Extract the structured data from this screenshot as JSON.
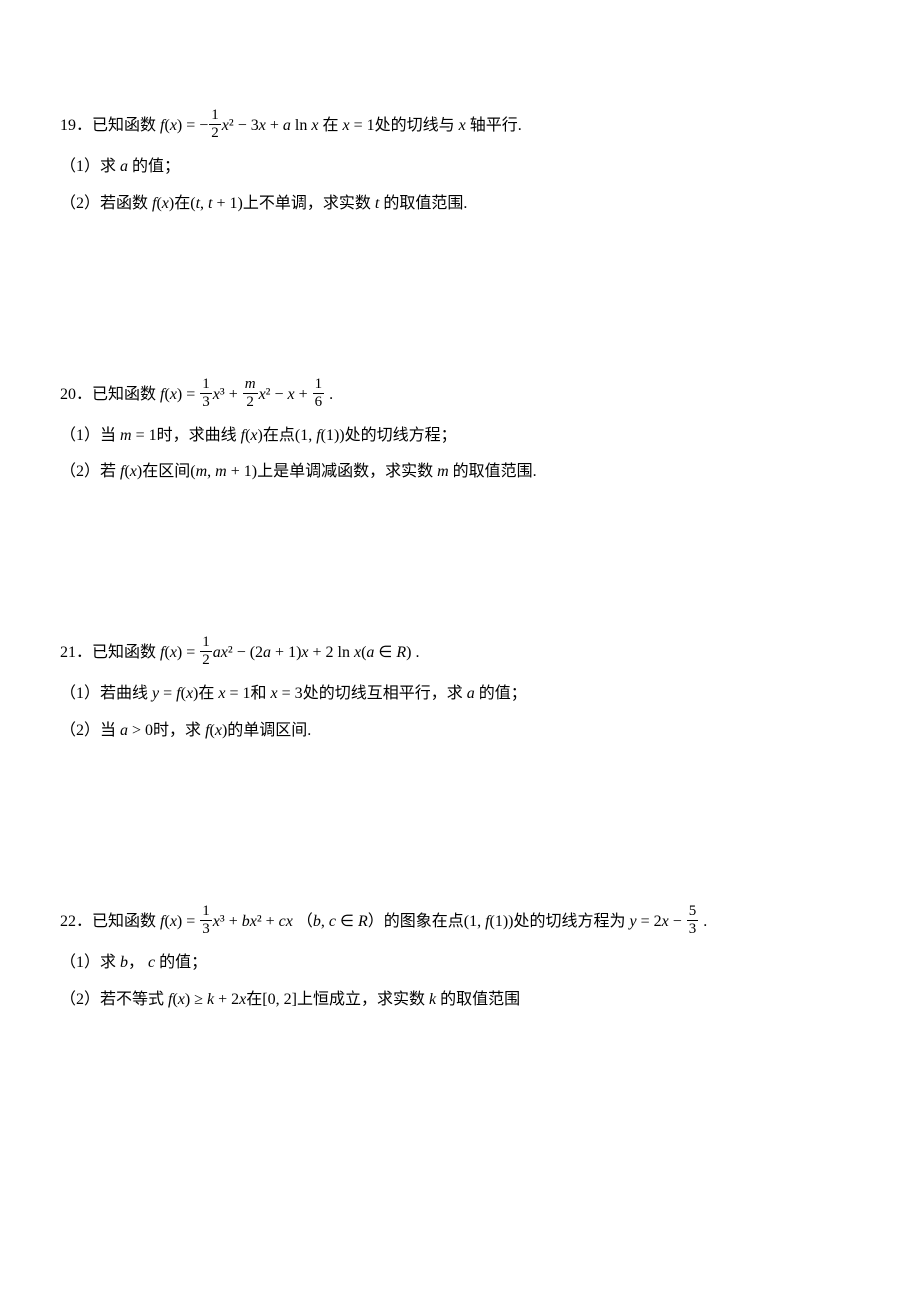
{
  "problems": {
    "p19": {
      "num": "19．",
      "stem_pre": "已知函数",
      "fx": "f",
      "stem_mid1": "(",
      "stem_mid2": ") = −",
      "frac1top": "1",
      "frac1bot": "2",
      "stem_mid3": "² − 3",
      "stem_mid4": " + ",
      "aln": "a",
      "ln": " ln ",
      "stem_mid5": " 在",
      "xeq1": " = 1",
      "stem_mid6": "处的切线与",
      "stem_mid7": "轴平行.",
      "part1": "（1）求",
      "part1_var": "a",
      "part1_end": "的值；",
      "part2": "（2）若函数",
      "part2_f": "f",
      "part2_mid1": "(",
      "part2_mid2": ")在(",
      "part2_t": "t",
      "part2_comma": ", ",
      "part2_t1": "t",
      "part2_plus1": " + 1)",
      "part2_end": "上不单调，求实数",
      "part2_tvar": "t",
      "part2_fin": "的取值范围."
    },
    "p20": {
      "num": "20．",
      "stem_pre": "已知函数",
      "fx": "f",
      "paren1": "(",
      "paren2": ") = ",
      "f1t": "1",
      "f1b": "3",
      "x3": "³ + ",
      "f2t_m": "m",
      "f2b": "2",
      "x2": "² − ",
      "xplus": " + ",
      "f3t": "1",
      "f3b": "6",
      "period": " .",
      "part1": "（1）当",
      "meq1": "m",
      "meq1b": " = 1",
      "part1_mid": "时，求曲线",
      "part1_f": "f",
      "part1_xp": "(",
      "part1_xp2": ")",
      "part1_mid2": "在点",
      "pt1": "(1, ",
      "pt_f": "f",
      "pt2": "(1))",
      "part1_end": "处的切线方程；",
      "part2": "（2）若",
      "p2_f": "f",
      "p2_x1": "(",
      "p2_x2": ")",
      "p2_mid": "在区间",
      "p2_int": "(",
      "p2_m1": "m",
      "p2_c": ", ",
      "p2_m2": "m",
      "p2_p1": " + 1)",
      "p2_mid2": "上是单调减函数，求实数",
      "p2_mv": "m",
      "p2_end": "的取值范围."
    },
    "p21": {
      "num": "21．",
      "stem_pre": "已知函数",
      "fx": "f",
      "p1": "(",
      "p2": ") = ",
      "f1t": "1",
      "f1b": "2",
      "ax2": "ax",
      "sq": "² − (2",
      "a": "a",
      "p1x": " + 1)",
      "xv": "x",
      "pln": " + 2 ln ",
      "xv2": "x",
      "ar": "(",
      "av": "a",
      "inr": " ∈ ",
      "rset": "R",
      "cp": ") .",
      "part1": "（1）若曲线",
      "yeq": "y",
      "eq": " = ",
      "ff": "f",
      "fp1": "(",
      "fp2": ")",
      "at": "在",
      "x1": " = 1",
      "and": "和",
      "x3": " = 3",
      "part1_end": "处的切线互相平行，求",
      "av2": "a",
      "part1_fin": "的值；",
      "part2": "（2）当",
      "agt0": "a",
      "gt0": " > 0",
      "part2_mid": "时，求",
      "fxx": "f",
      "fxp1": "(",
      "fxp2": ")",
      "part2_end": "的单调区间."
    },
    "p22": {
      "num": "22．",
      "stem_pre": "已知函数",
      "fx": "f",
      "p1": "(",
      "p2": ") = ",
      "f1t": "1",
      "f1b": "3",
      "x3": "³ + ",
      "bx2_b": "b",
      "bx2": "x",
      "sq": "² + ",
      "cx_c": "c",
      "cx": "x",
      "sp": "  （",
      "bc_b": "b",
      "bcc": ", ",
      "bc_c": "c",
      "inr": " ∈ ",
      "rset": "R",
      "cp": "）的图象在点",
      "pt1": "(1, ",
      "pt_f": "f",
      "pt2": "(1))",
      "mid": "处的切线方程为",
      "yeq": "y",
      "eq": " = 2",
      "xx": "x",
      "minus": " − ",
      "f2t": "5",
      "f2b": "3",
      "period": " .",
      "part1": "（1）求",
      "bv": "b",
      "comma": "，",
      "cv": "c",
      "part1_end": "的值；",
      "part2": "（2）若不等式",
      "ff": "f",
      "fp1": "(",
      "fp2": ") ≥ ",
      "kv": "k",
      "p2x": " + 2",
      "xv": "x",
      "on": "在",
      "int": "[0, 2]",
      "part2_mid": "上恒成立，求实数",
      "kv2": "k",
      "part2_end": "的取值范围"
    }
  }
}
